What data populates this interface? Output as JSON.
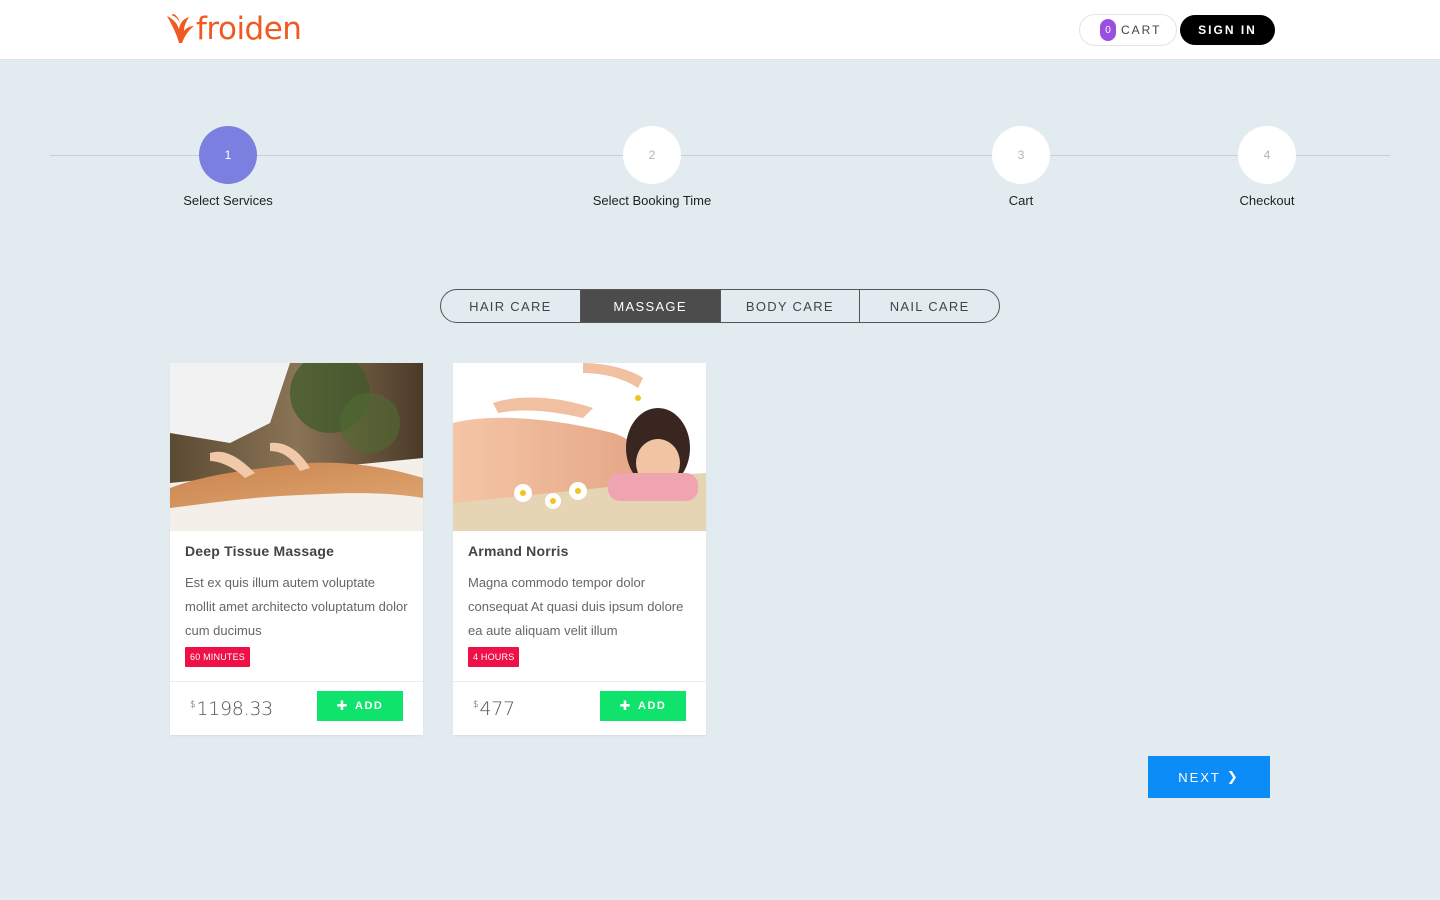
{
  "header": {
    "logo_text": "froiden",
    "cart_count": "0",
    "cart_label": "CART",
    "signin_label": "SIGN IN"
  },
  "steps": [
    {
      "number": "1",
      "label": "Select Services",
      "active": true
    },
    {
      "number": "2",
      "label": "Select Booking Time",
      "active": false
    },
    {
      "number": "3",
      "label": "Cart",
      "active": false
    },
    {
      "number": "4",
      "label": "Checkout",
      "active": false
    }
  ],
  "tabs": [
    {
      "label": "HAIR CARE",
      "active": false
    },
    {
      "label": "MASSAGE",
      "active": true
    },
    {
      "label": "BODY CARE",
      "active": false
    },
    {
      "label": "NAIL CARE",
      "active": false
    }
  ],
  "services": [
    {
      "title": "Deep Tissue Massage",
      "description": "Est ex quis illum autem voluptate mollit amet architecto voluptatum dolor cum ducimus",
      "duration": "60 MINUTES",
      "currency": "$",
      "price": "1198.33",
      "add_label": "ADD"
    },
    {
      "title": "Armand Norris",
      "description": "Magna commodo tempor dolor consequat At quasi duis ipsum dolore ea aute aliquam velit illum",
      "duration": "4 HOURS",
      "currency": "$",
      "price": "477",
      "add_label": "ADD"
    }
  ],
  "next_label": "NEXT",
  "colors": {
    "brand": "#f05a22",
    "active_step": "#7b7fe0",
    "badge": "#ef1048",
    "add_button": "#0fe36b",
    "next_button": "#0b8cf7",
    "background": "#e2ecf0"
  }
}
